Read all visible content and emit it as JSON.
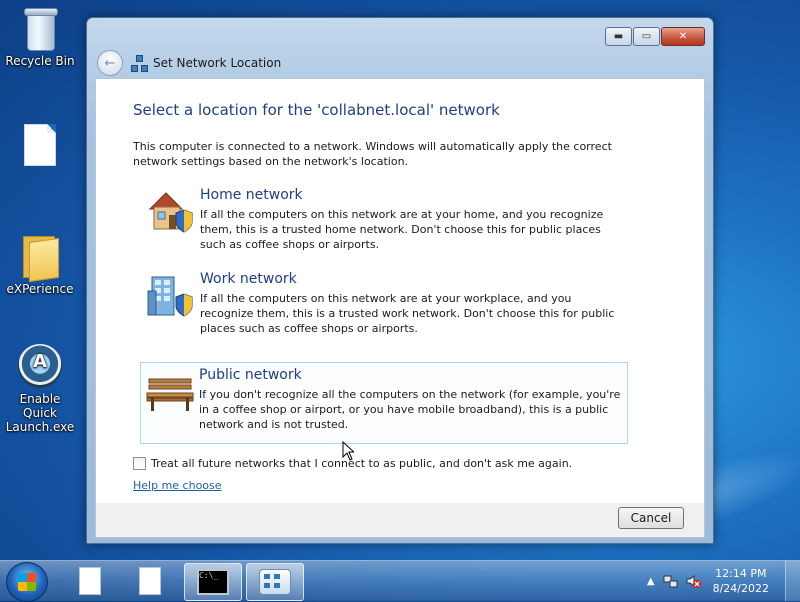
{
  "desktop": {
    "icons": [
      {
        "label": "Recycle Bin",
        "icon": "recycle-bin-icon"
      },
      {
        "label": "",
        "icon": "blank-document-icon"
      },
      {
        "label": "eXPerience",
        "icon": "folder-icon"
      },
      {
        "label": "Enable Quick Launch.exe",
        "icon": "app-icon"
      }
    ]
  },
  "window": {
    "title": "Set Network Location",
    "controls": {
      "minimize": "minimize-icon",
      "maximize": "maximize-icon",
      "close": "close-icon"
    },
    "heading": "Select a location for the 'collabnet.local' network",
    "intro": "This computer is connected to a network. Windows will automatically apply the correct network settings based on the network's location.",
    "options": [
      {
        "title": "Home network",
        "desc": "If all the computers on this network are at your home, and you recognize them, this is a trusted home network.  Don't choose this for public places such as coffee shops or airports.",
        "icon": "home-network-icon"
      },
      {
        "title": "Work network",
        "desc": "If all the computers on this network are at your workplace, and you recognize them, this is a trusted work network.  Don't choose this for public places such as coffee shops or airports.",
        "icon": "work-network-icon"
      },
      {
        "title": "Public network",
        "desc": "If you don't recognize all the computers on the network (for example, you're in a coffee shop or airport, or you have mobile broadband), this is a public network and is not trusted.",
        "icon": "public-network-icon"
      }
    ],
    "checkbox_label": "Treat all future networks that I connect to as public, and don't ask me again.",
    "checkbox_checked": false,
    "help_link": "Help me choose",
    "cancel_label": "Cancel"
  },
  "taskbar": {
    "clock_time": "12:14 PM",
    "clock_date": "8/24/2022",
    "tray_arrow": "▲",
    "items": [
      "document",
      "document",
      "command-prompt",
      "network-settings"
    ]
  },
  "colors": {
    "heading": "#1e3f87",
    "link": "#1e5fa8",
    "selected_border": "#a9d6ef"
  }
}
